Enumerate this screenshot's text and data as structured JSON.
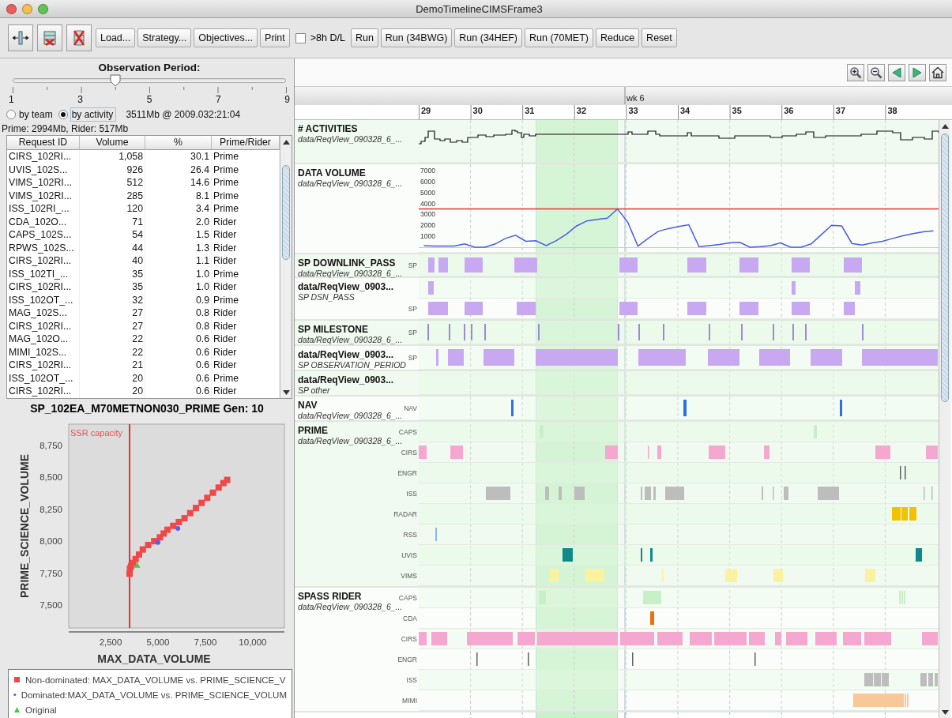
{
  "window": {
    "title": "DemoTimelineCIMSFrame3"
  },
  "toolbar": {
    "buttons": [
      "Load...",
      "Strategy...",
      "Objectives...",
      "Print"
    ],
    "checkbox": {
      "label": ">8h D/L",
      "checked": false
    },
    "run_buttons": [
      "Run",
      "Run (34BWG)",
      "Run (34HEF)",
      "Run (70MET)",
      "Reduce",
      "Reset"
    ]
  },
  "observation_period": {
    "label": "Observation Period:",
    "level": 0.375,
    "tick_labels": [
      "1",
      "3",
      "5",
      "7",
      "9"
    ]
  },
  "grouping": [
    {
      "label": "by team",
      "selected": false
    },
    {
      "label": "by activity",
      "selected": true
    }
  ],
  "summary": "3511Mb @ 2009.032:21:04",
  "totals": "Prime:  2994Mb, Rider:  517Mb",
  "table": {
    "columns": [
      "Request ID",
      "Volume",
      "%",
      "Prime/Rider"
    ],
    "rows": [
      [
        "CIRS_102RI...",
        "1,058",
        "30.1",
        "Prime"
      ],
      [
        "UVIS_102S...",
        "926",
        "26.4",
        "Prime"
      ],
      [
        "VIMS_102RI...",
        "512",
        "14.6",
        "Prime"
      ],
      [
        "VIMS_102RI...",
        "285",
        "8.1",
        "Prime"
      ],
      [
        "ISS_102RI_...",
        "120",
        "3.4",
        "Prime"
      ],
      [
        "CDA_102O...",
        "71",
        "2.0",
        "Rider"
      ],
      [
        "CAPS_102S...",
        "54",
        "1.5",
        "Rider"
      ],
      [
        "RPWS_102S...",
        "44",
        "1.3",
        "Rider"
      ],
      [
        "CIRS_102RI...",
        "40",
        "1.1",
        "Rider"
      ],
      [
        "ISS_102TI_...",
        "35",
        "1.0",
        "Prime"
      ],
      [
        "CIRS_102RI...",
        "35",
        "1.0",
        "Rider"
      ],
      [
        "ISS_102OT_...",
        "32",
        "0.9",
        "Prime"
      ],
      [
        "MAG_102S...",
        "27",
        "0.8",
        "Rider"
      ],
      [
        "CIRS_102RI...",
        "27",
        "0.8",
        "Rider"
      ],
      [
        "MAG_102O...",
        "22",
        "0.6",
        "Rider"
      ],
      [
        "MIMI_102S...",
        "22",
        "0.6",
        "Rider"
      ],
      [
        "CIRS_102RI...",
        "21",
        "0.6",
        "Rider"
      ],
      [
        "ISS_102OT_...",
        "20",
        "0.6",
        "Prime"
      ],
      [
        "CIRS_102RI...",
        "20",
        "0.6",
        "Rider"
      ]
    ]
  },
  "plot": {
    "chart_data": {
      "type": "scatter",
      "title": "SP_102EA_M70METNON030_PRIME Gen: 10",
      "xlabel": "MAX_DATA_VOLUME",
      "ylabel": "PRIME_SCIENCE_VOLUME",
      "xlim": [
        290,
        11670
      ],
      "ylim": [
        7320,
        8917
      ],
      "xticks": [
        {
          "value": 2500,
          "label": "2,500"
        },
        {
          "value": 5000,
          "label": "5,000"
        },
        {
          "value": 7500,
          "label": "7,500"
        },
        {
          "value": 10000,
          "label": "10,000"
        }
      ],
      "yticks": [
        {
          "value": 7500,
          "label": "7,500"
        },
        {
          "value": 7750,
          "label": "7,750"
        },
        {
          "value": 8000,
          "label": "8,000"
        },
        {
          "value": 8250,
          "label": "8,250"
        },
        {
          "value": 8500,
          "label": "8,500"
        },
        {
          "value": 8750,
          "label": "8,750"
        }
      ],
      "ref_lines": [
        {
          "axis": "x",
          "value": 3500,
          "label": "SSR capacity",
          "color": "#e83030"
        }
      ],
      "x": [
        3500,
        3520,
        3580,
        3680,
        3820,
        4000,
        4200,
        4480,
        4800,
        5100,
        5300,
        5500,
        5800,
        6100,
        6400,
        6700,
        7000,
        7300,
        7600,
        7900,
        8200,
        8450,
        8650,
        5000,
        6050,
        3900
      ],
      "series": [
        {
          "name": "Non-dominated: MAX_DATA_VOLUME vs. PRIME_SCIENCE_V",
          "color": "#f04848",
          "marker": "square",
          "values": [
            7745,
            7785,
            7805,
            7830,
            7860,
            7895,
            7935,
            7970,
            8000,
            8030,
            8060,
            8090,
            8120,
            8150,
            8180,
            8220,
            8260,
            8300,
            8340,
            8380,
            8420,
            8455,
            8480,
            null,
            null,
            null
          ]
        },
        {
          "name": "Dominated:MAX_DATA_VOLUME vs. PRIME_SCIENCE_VOLUM",
          "color": "#5a5af0",
          "marker": "circle",
          "values": [
            null,
            null,
            null,
            null,
            null,
            null,
            null,
            null,
            null,
            null,
            null,
            null,
            null,
            null,
            null,
            null,
            null,
            null,
            null,
            null,
            null,
            null,
            null,
            7990,
            8100,
            null
          ]
        },
        {
          "name": "Original",
          "color": "#44cc44",
          "marker": "triangle",
          "values": [
            null,
            null,
            null,
            null,
            null,
            null,
            null,
            null,
            null,
            null,
            null,
            null,
            null,
            null,
            null,
            null,
            null,
            null,
            null,
            null,
            null,
            null,
            null,
            null,
            null,
            7810
          ]
        }
      ]
    }
  },
  "timeline": {
    "week_label": "wk 6",
    "days": [
      "29",
      "30",
      "31",
      "32",
      "33",
      "34",
      "35",
      "36",
      "37",
      "38"
    ],
    "tracks": [
      {
        "kind": "sparkline",
        "title": "# ACTIVITIES",
        "subtitle": "data/ReqView_090328_6_..."
      },
      {
        "kind": "chart",
        "title": "DATA VOLUME",
        "subtitle": "data/ReqView_090328_6_...",
        "chart_data": {
          "type": "line",
          "categories": [
            null,
            null,
            null,
            null,
            null,
            null,
            null,
            null,
            null,
            null,
            null,
            null,
            null,
            null,
            null,
            null,
            null,
            null,
            null,
            null,
            null,
            null,
            null,
            null,
            null,
            null,
            null,
            null,
            null,
            null,
            null,
            null,
            null,
            null,
            null,
            null,
            null,
            null,
            null,
            null,
            null,
            null,
            null,
            null,
            null,
            null,
            null,
            null,
            null,
            null,
            null
          ],
          "ylim": [
            0,
            7000
          ],
          "yticks": [
            {
              "value": 1000,
              "label": "1000"
            },
            {
              "value": 2000,
              "label": "2000"
            },
            {
              "value": 3000,
              "label": "3000"
            },
            {
              "value": 4000,
              "label": "4000"
            },
            {
              "value": 5000,
              "label": "5000"
            },
            {
              "value": 6000,
              "label": "6000"
            },
            {
              "value": 7000,
              "label": "7000"
            }
          ],
          "series": [
            {
              "color": "#4a5ae8",
              "values": [
                150,
                100,
                100,
                100,
                300,
                0,
                0,
                300,
                800,
                1100,
                550,
                600,
                150,
                600,
                1200,
                1950,
                2400,
                2550,
                2650,
                3500,
                2300,
                100,
                800,
                1450,
                1700,
                1900,
                2050,
                50,
                150,
                250,
                400,
                450,
                0,
                50,
                150,
                400,
                0,
                0,
                300,
                1150,
                2000,
                1950,
                350,
                200,
                400,
                550,
                800,
                1050,
                1250,
                1400,
                1500
              ]
            }
          ],
          "ref_lines": [
            {
              "axis": "y",
              "value": 3500,
              "color": "#e83030"
            }
          ]
        }
      },
      {
        "kind": "rows",
        "title": "SP DOWNLINK_PASS",
        "subtitle": "data/ReqView_090328_6_...",
        "rows": [
          {
            "label": "SP",
            "color": "#c8a8f0"
          }
        ]
      },
      {
        "kind": "rows",
        "title": "data/ReqView_0903...",
        "subtitle": "SP DSN_PASS",
        "rows": [
          {
            "color": "#c8a8f0"
          },
          {
            "label": "SP",
            "color": "#c8a8f0"
          }
        ]
      },
      {
        "kind": "rows",
        "title": "SP MILESTONE",
        "subtitle": "data/ReqView_090328_6_...",
        "rows": [
          {
            "label": "SP",
            "color": "#a088d8"
          }
        ]
      },
      {
        "kind": "rows",
        "title": "data/ReqView_0903...",
        "subtitle": "SP OBSERVATION_PERIOD",
        "rows": [
          {
            "label": "SP",
            "color": "#c8a8f0"
          }
        ]
      },
      {
        "kind": "rows",
        "title": "data/ReqView_0903...",
        "subtitle": "SP other"
      },
      {
        "kind": "rows",
        "title": "NAV",
        "subtitle": "data/ReqView_090328_6_...",
        "rows": [
          {
            "label": "NAV",
            "color": "#2f6fe0"
          }
        ]
      },
      {
        "kind": "rows",
        "title": "PRIME",
        "subtitle": "data/ReqView_090328_6_...",
        "rows": [
          {
            "label": "CAPS",
            "color": "#c8f0c8"
          },
          {
            "label": "CIRS",
            "color": "#f4a8d0"
          },
          {
            "label": "ENGR",
            "color": "#606060"
          },
          {
            "label": "ISS",
            "color": "#bdbdbd"
          },
          {
            "label": "RADAR",
            "color": "#f2c200"
          },
          {
            "label": "RSS",
            "color": "#8ab8e8"
          },
          {
            "label": "UVIS",
            "color": "#108a88"
          },
          {
            "label": "VIMS",
            "color": "#fbf2a0"
          }
        ]
      },
      {
        "kind": "rows",
        "title": "SPASS RIDER",
        "subtitle": "data/ReqView_090328_6_...",
        "rows": [
          {
            "label": "CAPS",
            "color": "#c8f0c8"
          },
          {
            "label": "CDA",
            "color": "#f07010"
          },
          {
            "label": "CIRS",
            "color": "#f4a8d0"
          },
          {
            "label": "ENGR",
            "color": "#606060"
          },
          {
            "label": "ISS",
            "color": "#bdbdbd"
          },
          {
            "label": "MIMI",
            "color": "#f8c898"
          }
        ]
      }
    ]
  }
}
